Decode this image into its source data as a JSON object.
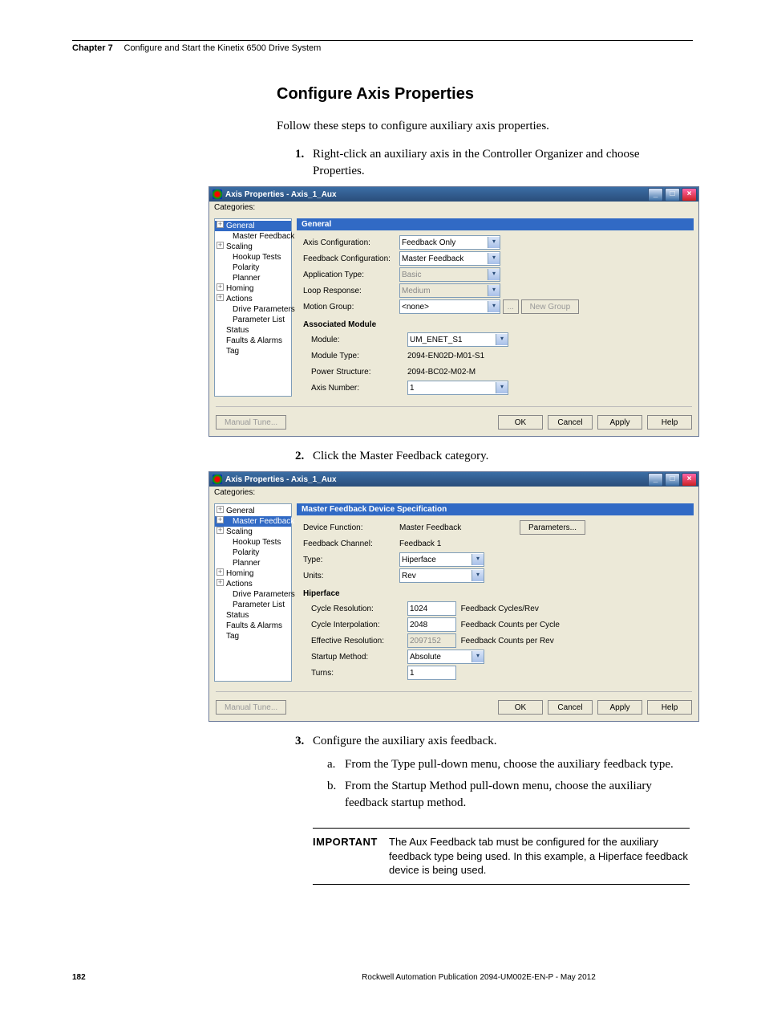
{
  "header": {
    "chapter_label": "Chapter 7",
    "chapter_title": "Configure and Start the Kinetix 6500 Drive System"
  },
  "section_title": "Configure Axis Properties",
  "intro": "Follow these steps to configure auxiliary axis properties.",
  "steps": {
    "s1_num": "1.",
    "s1_text": "Right-click an auxiliary axis in the Controller Organizer and choose Properties.",
    "s2_num": "2.",
    "s2_text": "Click the Master Feedback category.",
    "s3_num": "3.",
    "s3_text": "Configure the auxiliary axis feedback.",
    "s3a_letter": "a.",
    "s3a_text": "From the Type pull-down menu, choose the auxiliary feedback type.",
    "s3b_letter": "b.",
    "s3b_text": "From the Startup Method pull-down menu, choose the auxiliary feedback startup method."
  },
  "dialog1": {
    "title": "Axis Properties - Axis_1_Aux",
    "categories_label": "Categories:",
    "tree": {
      "general": "General",
      "master_feedback": "Master Feedback",
      "scaling": "Scaling",
      "hookup": "Hookup Tests",
      "polarity": "Polarity",
      "planner": "Planner",
      "homing": "Homing",
      "actions": "Actions",
      "drive_params": "Drive Parameters",
      "param_list": "Parameter List",
      "status": "Status",
      "faults": "Faults & Alarms",
      "tag": "Tag"
    },
    "panel_header": "General",
    "labels": {
      "axis_config": "Axis Configuration:",
      "feedback_config": "Feedback Configuration:",
      "app_type": "Application Type:",
      "loop_resp": "Loop Response:",
      "motion_group": "Motion Group:",
      "assoc_module": "Associated Module",
      "module": "Module:",
      "module_type": "Module Type:",
      "power_struct": "Power Structure:",
      "axis_number": "Axis Number:"
    },
    "values": {
      "axis_config": "Feedback Only",
      "feedback_config": "Master Feedback",
      "app_type": "Basic",
      "loop_resp": "Medium",
      "motion_group": "<none>",
      "module": "UM_ENET_S1",
      "module_type": "2094-EN02D-M01-S1",
      "power_struct": "2094-BC02-M02-M",
      "axis_number": "1"
    },
    "buttons": {
      "ellipsis": "...",
      "new_group": "New Group",
      "manual_tune": "Manual Tune...",
      "ok": "OK",
      "cancel": "Cancel",
      "apply": "Apply",
      "help": "Help"
    }
  },
  "dialog2": {
    "title": "Axis Properties - Axis_1_Aux",
    "categories_label": "Categories:",
    "tree": {
      "general": "General",
      "master_feedback": "Master Feedback",
      "scaling": "Scaling",
      "hookup": "Hookup Tests",
      "polarity": "Polarity",
      "planner": "Planner",
      "homing": "Homing",
      "actions": "Actions",
      "drive_params": "Drive Parameters",
      "param_list": "Parameter List",
      "status": "Status",
      "faults": "Faults & Alarms",
      "tag": "Tag"
    },
    "panel_header": "Master Feedback Device Specification",
    "labels": {
      "device_function": "Device Function:",
      "feedback_channel": "Feedback Channel:",
      "type": "Type:",
      "units": "Units:",
      "hiperface": "Hiperface",
      "cycle_res": "Cycle Resolution:",
      "cycle_interp": "Cycle Interpolation:",
      "eff_res": "Effective Resolution:",
      "startup": "Startup Method:",
      "turns": "Turns:"
    },
    "values": {
      "device_function": "Master Feedback",
      "feedback_channel": "Feedback 1",
      "type": "Hiperface",
      "units": "Rev",
      "cycle_res": "1024",
      "cycle_res_unit": "Feedback Cycles/Rev",
      "cycle_interp": "2048",
      "cycle_interp_unit": "Feedback Counts per Cycle",
      "eff_res": "2097152",
      "eff_res_unit": "Feedback Counts per Rev",
      "startup": "Absolute",
      "turns": "1"
    },
    "buttons": {
      "parameters": "Parameters...",
      "manual_tune": "Manual Tune...",
      "ok": "OK",
      "cancel": "Cancel",
      "apply": "Apply",
      "help": "Help"
    }
  },
  "important": {
    "label": "IMPORTANT",
    "text": "The Aux Feedback tab must be configured for the auxiliary feedback type being used. In this example, a Hiperface feedback device is being used."
  },
  "footer": {
    "page": "182",
    "pub": "Rockwell Automation Publication 2094-UM002E-EN-P - May 2012"
  }
}
